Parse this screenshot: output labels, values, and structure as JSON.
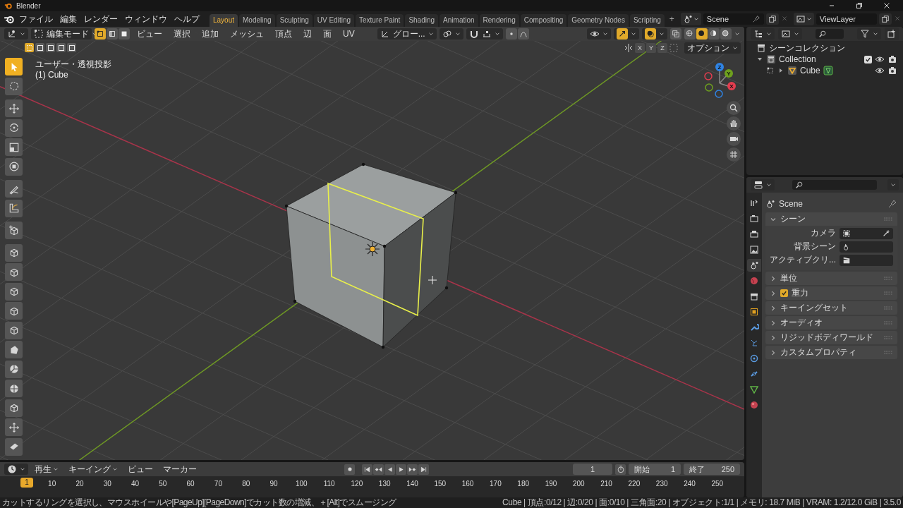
{
  "window": {
    "title": "Blender"
  },
  "menus": [
    "ファイル",
    "編集",
    "レンダー",
    "ウィンドウ",
    "ヘルプ"
  ],
  "workspaces": [
    {
      "label": "Layout",
      "selected": true
    },
    {
      "label": "Modeling",
      "selected": false
    },
    {
      "label": "Sculpting",
      "selected": false
    },
    {
      "label": "UV Editing",
      "selected": false
    },
    {
      "label": "Texture Paint",
      "selected": false
    },
    {
      "label": "Shading",
      "selected": false
    },
    {
      "label": "Animation",
      "selected": false
    },
    {
      "label": "Rendering",
      "selected": false
    },
    {
      "label": "Compositing",
      "selected": false
    },
    {
      "label": "Geometry Nodes",
      "selected": false
    },
    {
      "label": "Scripting",
      "selected": false
    }
  ],
  "add_workspace": "+",
  "scene": "Scene",
  "view_layer": "ViewLayer",
  "viewport": {
    "mode": "編集モード",
    "select_modes": [
      {
        "selected": true
      },
      {
        "selected": false
      },
      {
        "selected": false
      }
    ],
    "menus": [
      "ビュー",
      "選択",
      "追加",
      "メッシュ",
      "頂点",
      "辺",
      "面",
      "UV"
    ],
    "orientation": "グロー...",
    "proportional_on": false,
    "gizmos_on": true,
    "overlays_on": true,
    "shading": [
      {
        "selected": false
      },
      {
        "selected": true
      },
      {
        "selected": false
      },
      {
        "selected": false
      }
    ],
    "box_modes": [
      {
        "selected": true
      },
      {
        "selected": false
      },
      {
        "selected": false
      },
      {
        "selected": false
      },
      {
        "selected": false
      }
    ],
    "view_name": "ユーザー・透視投影",
    "object_name": "(1) Cube",
    "mirror_axes": [
      {
        "label": "X",
        "on": false
      },
      {
        "label": "Y",
        "on": false
      },
      {
        "label": "Z",
        "on": false
      }
    ],
    "options": "オプション",
    "gizmo": [
      {
        "label": "Z",
        "color": "#2f83e3"
      },
      {
        "label": "Y",
        "color": "#6ea01e"
      },
      {
        "label": "X",
        "color": "#e33d4f"
      }
    ],
    "tools": [
      {
        "selected": true
      },
      {
        "selected": false
      },
      {
        "selected": false
      },
      {
        "selected": false
      },
      {
        "selected": false
      },
      {
        "selected": false
      },
      {
        "selected": false
      },
      {
        "selected": false
      },
      {
        "selected": false
      },
      {
        "selected": false
      },
      {
        "selected": false
      },
      {
        "selected": false
      },
      {
        "selected": false
      },
      {
        "selected": false
      },
      {
        "selected": false
      },
      {
        "selected": false
      },
      {
        "selected": false
      },
      {
        "selected": false
      },
      {
        "selected": false
      },
      {
        "selected": false
      }
    ]
  },
  "outliner": {
    "root": "シーンコレクション",
    "items": [
      {
        "label": "Collection",
        "expanded": true,
        "checked": true,
        "children": [
          {
            "label": "Cube",
            "expanded": false
          }
        ]
      }
    ]
  },
  "properties": {
    "tabs": [
      {
        "selected": false
      },
      {
        "selected": false
      },
      {
        "selected": false
      },
      {
        "selected": false
      },
      {
        "selected": true
      },
      {
        "selected": false
      },
      {
        "selected": false
      },
      {
        "selected": false
      },
      {
        "selected": false
      },
      {
        "selected": false
      },
      {
        "selected": false
      },
      {
        "selected": false
      },
      {
        "selected": false
      },
      {
        "selected": false
      }
    ],
    "title": "Scene",
    "panels": [
      {
        "label": "シーン",
        "expanded": true,
        "fields": [
          {
            "label": "カメラ"
          },
          {
            "label": "背景シーン"
          },
          {
            "label": "アクティブクリ..."
          }
        ]
      },
      {
        "label": "単位",
        "expanded": false
      },
      {
        "label": "重力",
        "expanded": false,
        "checked": true
      },
      {
        "label": "キーイングセット",
        "expanded": false
      },
      {
        "label": "オーディオ",
        "expanded": false
      },
      {
        "label": "リジッドボディワールド",
        "expanded": false
      },
      {
        "label": "カスタムプロパティ",
        "expanded": false
      }
    ]
  },
  "timeline": {
    "menus": [
      {
        "label": "再生",
        "dropdown": true
      },
      {
        "label": "キーイング",
        "dropdown": true
      },
      {
        "label": "ビュー",
        "dropdown": false
      },
      {
        "label": "マーカー",
        "dropdown": false
      }
    ],
    "current_frame": "1",
    "start_label": "開始",
    "start": "1",
    "end_label": "終了",
    "end": "250",
    "playhead": "1",
    "ruler": [
      "10",
      "20",
      "30",
      "40",
      "50",
      "60",
      "70",
      "80",
      "90",
      "100",
      "110",
      "120",
      "130",
      "140",
      "150",
      "160",
      "170",
      "180",
      "190",
      "200",
      "210",
      "220",
      "230",
      "240",
      "250"
    ]
  },
  "status_bar": {
    "message": "カットするリングを選択し、マウスホイールや[PageUp][PageDown]でカット数の増減、＋[Alt]でスムージング",
    "stats": "Cube | 頂点:0/12 | 辺:0/20 | 面:0/10 | 三角面:20 | オブジェクト:1/1 | メモリ: 18.7 MiB | VRAM: 1.2/12.0 GiB | 3.5.0"
  }
}
